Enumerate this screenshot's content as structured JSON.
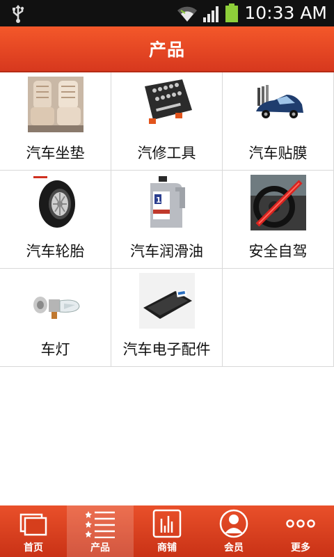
{
  "status_bar": {
    "time": "10:33 AM",
    "icons": [
      "usb-icon",
      "wifi-icon",
      "signal-icon",
      "battery-icon"
    ]
  },
  "header": {
    "title": "产品"
  },
  "products": [
    {
      "label": "汽车坐垫",
      "icon": "seat-cushion-image"
    },
    {
      "label": "汽修工具",
      "icon": "tool-kit-image"
    },
    {
      "label": "汽车贴膜",
      "icon": "car-film-image"
    },
    {
      "label": "汽车轮胎",
      "icon": "tire-image"
    },
    {
      "label": "汽车润滑油",
      "icon": "motor-oil-image"
    },
    {
      "label": "安全自驾",
      "icon": "steering-lock-image"
    },
    {
      "label": "车灯",
      "icon": "headlight-bulb-image"
    },
    {
      "label": "汽车电子配件",
      "icon": "electronics-image"
    }
  ],
  "bottom_nav": {
    "items": [
      {
        "label": "首页",
        "icon": "home-icon"
      },
      {
        "label": "产品",
        "icon": "product-list-icon",
        "active": true
      },
      {
        "label": "商铺",
        "icon": "shop-icon"
      },
      {
        "label": "会员",
        "icon": "member-icon"
      },
      {
        "label": "更多",
        "icon": "more-icon"
      }
    ]
  },
  "colors": {
    "header_red": "#e2401f",
    "nav_red": "#d63e1c",
    "grid_border": "#d8d8d8"
  }
}
